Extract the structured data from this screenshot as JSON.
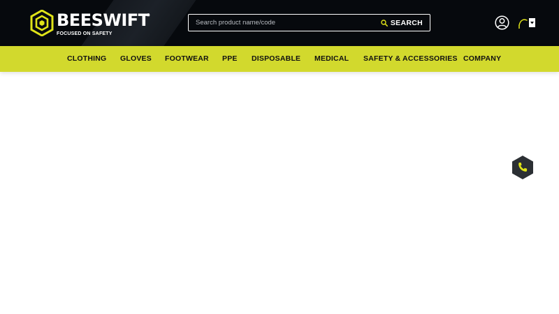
{
  "brand": {
    "name": "BEESWIFT",
    "registered": "®",
    "tagline": "FOCUSED ON SAFETY"
  },
  "search": {
    "placeholder": "Search product name/code",
    "button_label": "SEARCH"
  },
  "header_icons": {
    "account_icon": "user-circle-icon",
    "basket_icon": "basket-icon",
    "search_icon": "magnifier-icon"
  },
  "nav": {
    "items": [
      {
        "label": "CLOTHING"
      },
      {
        "label": "GLOVES"
      },
      {
        "label": "FOOTWEAR"
      },
      {
        "label": "PPE"
      },
      {
        "label": "DISPOSABLE"
      },
      {
        "label": "MEDICAL"
      },
      {
        "label": "SAFETY & ACCESSORIES"
      },
      {
        "label": "COMPANY"
      }
    ]
  },
  "floating": {
    "phone_icon": "phone-icon"
  },
  "colors": {
    "header_bg": "#06090d",
    "accent": "#d2d92d",
    "logo_yellow": "#dfe318",
    "nav_text": "#111111",
    "phone_hex_bg": "#2b2f33"
  }
}
